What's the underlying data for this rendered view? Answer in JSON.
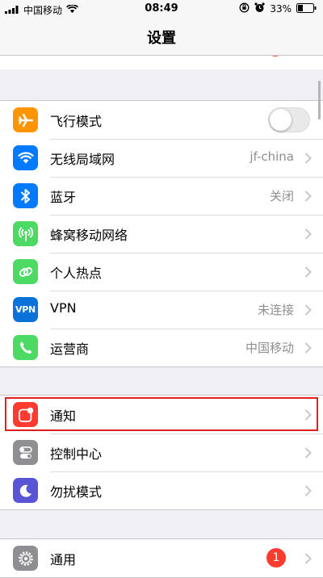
{
  "status_bar": {
    "carrier": "中国移动",
    "time": "08:49",
    "battery": "33%"
  },
  "nav": {
    "title": "设置"
  },
  "colors": {
    "airplane": "#ff9500",
    "wifi": "#007aff",
    "bluetooth": "#007aff",
    "cellular": "#4cd964",
    "hotspot": "#4cd964",
    "vpn": "#0a72d8",
    "carrier": "#4cd964",
    "notifications": "#ff3b30",
    "control_center": "#8e8e93",
    "dnd": "#5856d6",
    "general": "#8e8e93",
    "highlight": "#e02020"
  },
  "group1": {
    "airplane": {
      "label": "飞行模式",
      "toggle_on": false
    },
    "wifi": {
      "label": "无线局域网",
      "value": "jf-china"
    },
    "bluetooth": {
      "label": "蓝牙",
      "value": "关闭"
    },
    "cellular": {
      "label": "蜂窝移动网络"
    },
    "hotspot": {
      "label": "个人热点"
    },
    "vpn": {
      "label": "VPN",
      "icon_text": "VPN",
      "value": "未连接"
    },
    "carrier": {
      "label": "运营商",
      "value": "中国移动"
    }
  },
  "group2": {
    "notifications": {
      "label": "通知"
    },
    "control_center": {
      "label": "控制中心"
    },
    "dnd": {
      "label": "勿扰模式"
    }
  },
  "group3": {
    "general": {
      "label": "通用",
      "badge": "1"
    }
  }
}
